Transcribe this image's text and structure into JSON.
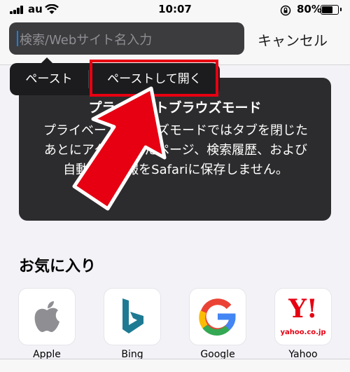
{
  "status_bar": {
    "carrier": "au",
    "time": "10:07",
    "battery_percent": "80%",
    "battery_level": 0.8,
    "icons": [
      "signal-icon",
      "wifi-icon",
      "orientation-lock-icon",
      "battery-icon"
    ]
  },
  "search": {
    "placeholder": "検索/Webサイト名入力"
  },
  "cancel_label": "キャンセル",
  "context_menu": {
    "items": [
      {
        "label": "ペースト"
      },
      {
        "label": "ペーストして開く"
      }
    ]
  },
  "private_card": {
    "title": "プライベートブラウズモード",
    "body": "プライベートブラウズモードではタブを閉じたあとにアクセスしたページ、検索履歴、および自動入力情報をSafariに保存しません。"
  },
  "favorites": {
    "title": "お気に入り",
    "items": [
      {
        "label": "Apple",
        "icon": "apple-icon"
      },
      {
        "label": "Bing",
        "icon": "bing-icon"
      },
      {
        "label": "Google",
        "icon": "google-icon"
      },
      {
        "label": "Yahoo",
        "icon": "yahoo-japan-icon",
        "logo_text": "Y!",
        "logo_subtext": "yahoo.co.jp"
      }
    ]
  },
  "colors": {
    "highlight_red": "#e60012",
    "card_bg": "#2c2c2e",
    "search_bg": "#3c3c3e",
    "caret_blue": "#0a84ff"
  }
}
